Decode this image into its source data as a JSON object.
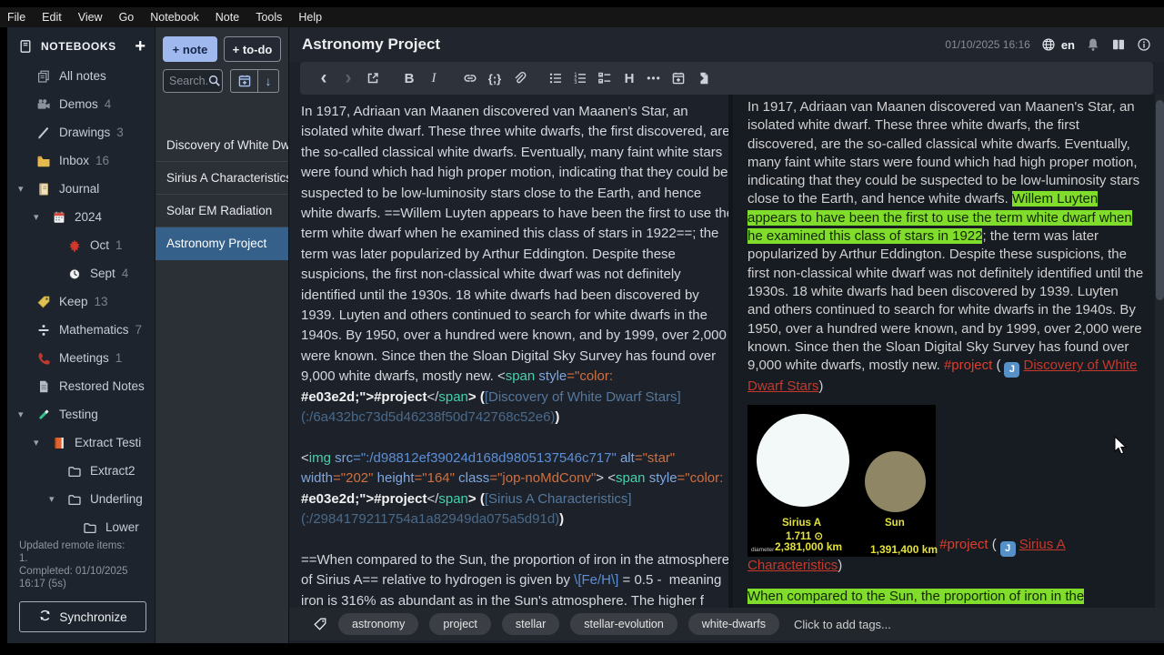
{
  "menu": {
    "items": [
      "File",
      "Edit",
      "View",
      "Go",
      "Notebook",
      "Note",
      "Tools",
      "Help"
    ]
  },
  "sidebar": {
    "header": "NOTEBOOKS",
    "items": [
      {
        "label": "All notes",
        "icon": "all-notes",
        "depth": 0,
        "count": "",
        "arrow": false
      },
      {
        "label": "Demos",
        "icon": "movie-camera",
        "depth": 0,
        "count": "4",
        "arrow": false
      },
      {
        "label": "Drawings",
        "icon": "pencil",
        "depth": 0,
        "count": "3",
        "arrow": false
      },
      {
        "label": "Inbox",
        "icon": "folder",
        "depth": 0,
        "count": "16",
        "arrow": false
      },
      {
        "label": "Journal",
        "icon": "journal",
        "depth": 0,
        "count": "",
        "arrow": true
      },
      {
        "label": "2024",
        "icon": "calendar",
        "depth": 1,
        "count": "",
        "arrow": true
      },
      {
        "label": "Oct",
        "icon": "maple-leaf",
        "depth": 2,
        "count": "1",
        "arrow": false
      },
      {
        "label": "Sept",
        "icon": "clock",
        "depth": 2,
        "count": "4",
        "arrow": false
      },
      {
        "label": "Keep",
        "icon": "tag",
        "depth": 0,
        "count": "13",
        "arrow": false
      },
      {
        "label": "Mathematics",
        "icon": "divide",
        "depth": 0,
        "count": "7",
        "arrow": false
      },
      {
        "label": "Meetings",
        "icon": "phone",
        "depth": 0,
        "count": "1",
        "arrow": false
      },
      {
        "label": "Restored Notes",
        "icon": "note",
        "depth": 0,
        "count": "",
        "arrow": false
      },
      {
        "label": "Testing",
        "icon": "test-tube",
        "depth": 0,
        "count": "",
        "arrow": true
      },
      {
        "label": "Extract Testi",
        "icon": "orange-book",
        "depth": 1,
        "count": "",
        "arrow": true
      },
      {
        "label": "Extract2",
        "icon": "folder-outline",
        "depth": 2,
        "count": "",
        "arrow": false
      },
      {
        "label": "Underling",
        "icon": "folder-outline",
        "depth": 2,
        "count": "",
        "arrow": true
      },
      {
        "label": "Lower",
        "icon": "folder-outline",
        "depth": 3,
        "count": "",
        "arrow": false
      }
    ],
    "sync_status_lines": [
      "Updated remote items:",
      "1.",
      "Completed: 01/10/2025",
      "16:17 (5s)"
    ],
    "sync_button": "Synchronize"
  },
  "notelist": {
    "new_note": "+ note",
    "new_todo": "+ to-do",
    "search_placeholder": "Search...",
    "notes": [
      {
        "title": "Discovery of White Dwa",
        "selected": false
      },
      {
        "title": "Sirius A Characteristics",
        "selected": false
      },
      {
        "title": "Solar EM Radiation",
        "selected": false
      },
      {
        "title": "Astronomy Project",
        "selected": true
      }
    ]
  },
  "note_header": {
    "title": "Astronomy Project",
    "datetime": "01/10/2025 16:16",
    "language": "en"
  },
  "toolbar": {
    "markdown_toggle": "M↓"
  },
  "editor": {
    "lines": [
      [
        [
          "In 1917, Adriaan van Maanen discovered van Maanen's Star, an",
          "p"
        ]
      ],
      [
        [
          "isolated white dwarf. These three white dwarfs, the first discovered, are",
          "p"
        ]
      ],
      [
        [
          "the so-called classical white dwarfs. Eventually, many faint white stars",
          "p"
        ]
      ],
      [
        [
          "were found which had high proper motion, indicating that they could be",
          "p"
        ]
      ],
      [
        [
          "suspected to be low-luminosity stars close to the Earth, and hence",
          "p"
        ]
      ],
      [
        [
          "white dwarfs. ==Willem Luyten appears to have been the first to use the",
          "p"
        ]
      ],
      [
        [
          "term white dwarf when he examined this class of stars in 1922==; the",
          "p"
        ]
      ],
      [
        [
          "term was later popularized by Arthur Eddington. Despite these",
          "p"
        ]
      ],
      [
        [
          "suspicions, the first non-classical white dwarf was not definitely",
          "p"
        ]
      ],
      [
        [
          "identified until the 1930s. 18 white dwarfs had been discovered by",
          "p"
        ]
      ],
      [
        [
          "1939. Luyten and others continued to search for white dwarfs in the",
          "p"
        ]
      ],
      [
        [
          "1940s. By 1950, over a hundred were known, and by 1999, over 2,000",
          "p"
        ]
      ],
      [
        [
          "were known. Since then the Sloan Digital Sky Survey has found over",
          "p"
        ]
      ],
      [
        [
          "9,000 white dwarfs, mostly new. ",
          "p"
        ],
        [
          "<",
          "p"
        ],
        [
          "span",
          "tag"
        ],
        [
          " ",
          "p"
        ],
        [
          "style",
          "attr"
        ],
        [
          "=\"",
          "str"
        ],
        [
          "color:",
          "str"
        ]
      ],
      [
        [
          "#e03e2d;\">#project",
          "pb"
        ],
        [
          "</",
          "p"
        ],
        [
          "span",
          "tag"
        ],
        [
          ">",
          "pb"
        ],
        [
          " (",
          "pb"
        ],
        [
          "[Discovery of White Dwarf Stars]",
          "dimlink"
        ]
      ],
      [
        [
          "(:/6a432bc73d5d46238f50d742768c52e6)",
          "dimurl"
        ],
        [
          ")",
          "pb"
        ]
      ],
      [],
      [
        [
          "<",
          "p"
        ],
        [
          "img",
          "tag"
        ],
        [
          " ",
          "p"
        ],
        [
          "src",
          "attr"
        ],
        [
          "=\":/d98812ef39024d168d9805137546c717\"",
          "vblue"
        ],
        [
          " ",
          "p"
        ],
        [
          "alt",
          "attr"
        ],
        [
          "=\"star\"",
          "str"
        ]
      ],
      [
        [
          "width",
          "attr"
        ],
        [
          "=\"202\"",
          "str"
        ],
        [
          " ",
          "p"
        ],
        [
          "height",
          "attr"
        ],
        [
          "=\"164\"",
          "str"
        ],
        [
          " ",
          "p"
        ],
        [
          "class",
          "attr"
        ],
        [
          "=\"jop-noMdConv\"",
          "str"
        ],
        [
          "> ",
          "p"
        ],
        [
          "<",
          "p"
        ],
        [
          "span",
          "tag"
        ],
        [
          " ",
          "p"
        ],
        [
          "style",
          "attr"
        ],
        [
          "=\"",
          "str"
        ],
        [
          "color:",
          "str"
        ]
      ],
      [
        [
          "#e03e2d;\">#project",
          "pb"
        ],
        [
          "</",
          "p"
        ],
        [
          "span",
          "tag"
        ],
        [
          ">",
          "pb"
        ],
        [
          " (",
          "pb"
        ],
        [
          "[Sirius A Characteristics]",
          "dimlink"
        ]
      ],
      [
        [
          "(:/2984179211754a1a82949da075a5d91d)",
          "dimurl"
        ],
        [
          ")",
          "pb"
        ]
      ],
      [],
      [
        [
          "==When compared to the Sun, the proportion of iron in the atmosphere",
          "p"
        ]
      ],
      [
        [
          "of Sirius A== relative to hydrogen is given by ",
          "p"
        ],
        [
          "\\[Fe/H\\]",
          "vblue"
        ],
        [
          " = 0.5 -  meaning",
          "p"
        ]
      ],
      [
        [
          "iron is 316% as abundant as in the Sun's atmosphere. The higher f",
          "p"
        ]
      ]
    ]
  },
  "preview": {
    "para1": [
      [
        "In 1917, Adriaan van Maanen discovered van Maanen's Star, an isolated white dwarf. These three white dwarfs, the first discovered, are the so-called classical white dwarfs.  Eventually, many faint white stars were found which had high proper motion, indicating that they could be suspected to be low-luminosity stars close to the Earth, and hence white dwarfs. ",
        "plain"
      ],
      [
        "Willem Luyten appears to have been the first to use the term white dwarf when he examined this class of stars in 1922",
        "mark"
      ],
      [
        "; the term was later popularized by Arthur Eddington. Despite these suspicions, the first non-classical white dwarf was not definitely identified until the 1930s. 18 white dwarfs had been discovered by 1939. Luyten and others continued to search for white dwarfs in the 1940s. By 1950, over a hundred were known, and by 1999, over 2,000 were known. Since then the Sloan Digital Sky Survey has found over 9,000 white dwarfs, mostly new. ",
        "plain"
      ],
      [
        "#project",
        "tag"
      ],
      [
        " (",
        "plain"
      ],
      [
        "joplin",
        "icon"
      ],
      [
        "Discovery of White Dwarf Stars",
        "link"
      ],
      [
        ")",
        "plain"
      ]
    ],
    "para2_after_image": [
      [
        "#project",
        "tag"
      ],
      [
        " (",
        "plain"
      ],
      [
        "joplin",
        "icon"
      ],
      [
        "Sirius A Characteristics",
        "link"
      ],
      [
        ")",
        "plain"
      ]
    ],
    "para3": [
      [
        "When compared to the Sun, the proportion of iron in the",
        "mark"
      ]
    ]
  },
  "star_image": {
    "sirius_label": "Sirius A",
    "sirius_radius": "1.711 ⊙",
    "sirius_diameter": "2,381,000 km",
    "sun_label": "Sun",
    "sun_diameter": "1,391,400 km",
    "diameter_caption": "diameter"
  },
  "tags": {
    "items": [
      "astronomy",
      "project",
      "stellar",
      "stellar-evolution",
      "white-dwarfs"
    ],
    "add_hint": "Click to add tags..."
  },
  "colors": {
    "accent_red": "#e03e2d",
    "highlight_green": "#80dd2b",
    "selected_note_blue": "#35608a",
    "new_note_button_blue": "#9fb9ee"
  }
}
